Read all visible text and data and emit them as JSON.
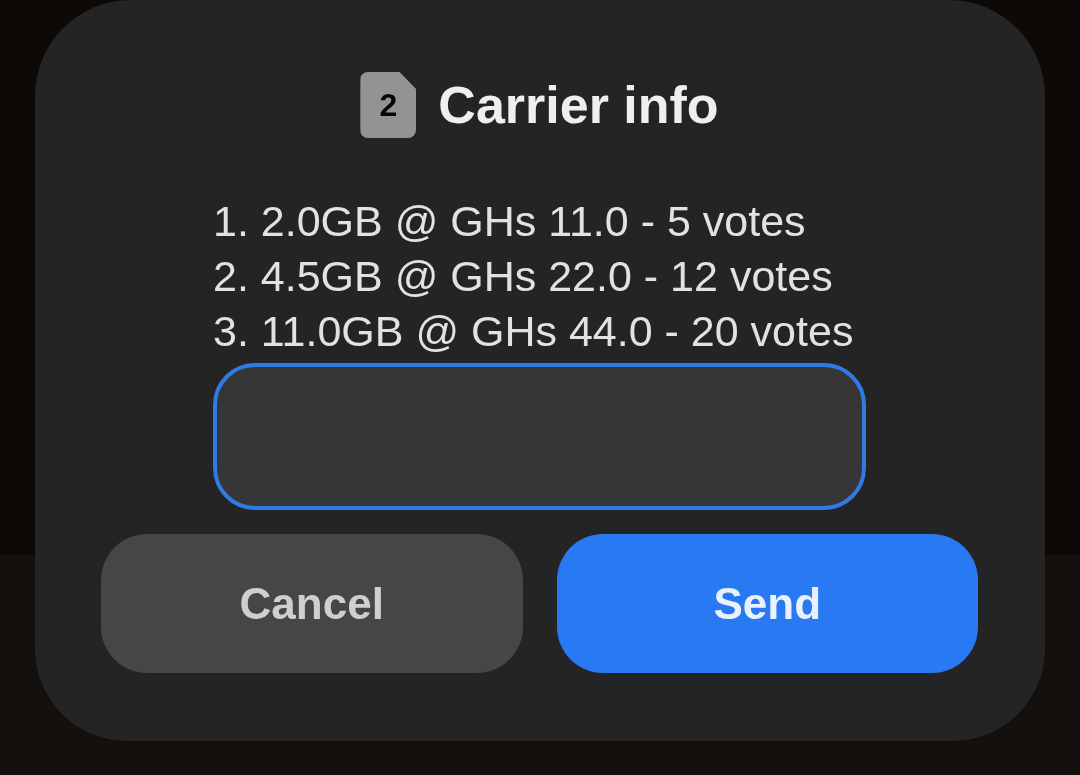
{
  "dialog": {
    "sim_icon": {
      "label": "2"
    },
    "title": "Carrier info",
    "options": [
      "1. 2.0GB @ GHs 11.0 - 5 votes",
      "2. 4.5GB @ GHs 22.0 - 12 votes",
      "3. 11.0GB @ GHs 44.0 - 20 votes"
    ],
    "input": {
      "focused": true
    },
    "buttons": [
      {
        "label": "Cancel",
        "kind": "secondary"
      },
      {
        "label": "Send",
        "kind": "primary"
      }
    ]
  }
}
